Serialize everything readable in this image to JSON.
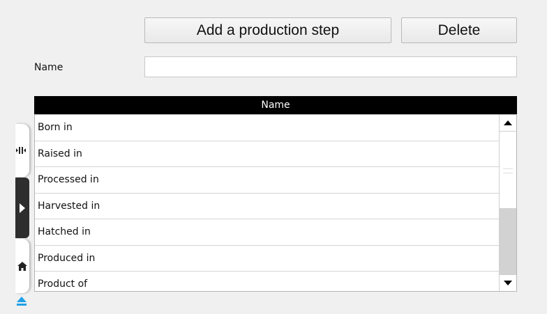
{
  "toolbar": {
    "add_label": "Add a production step",
    "delete_label": "Delete"
  },
  "form": {
    "name_label": "Name",
    "name_value": ""
  },
  "grid": {
    "column_header": "Name",
    "rows": [
      "Born in",
      "Raised in",
      "Processed in",
      "Harvested in",
      "Hatched in",
      "Produced in",
      "Product of"
    ]
  },
  "side_tabs": {
    "icons": [
      "split-icon",
      "play-icon",
      "home-icon",
      "eject-icon"
    ]
  },
  "colors": {
    "header_bg": "#000000",
    "scroll_track": "#d2d2d2",
    "eject_blue": "#1fa0e6"
  }
}
